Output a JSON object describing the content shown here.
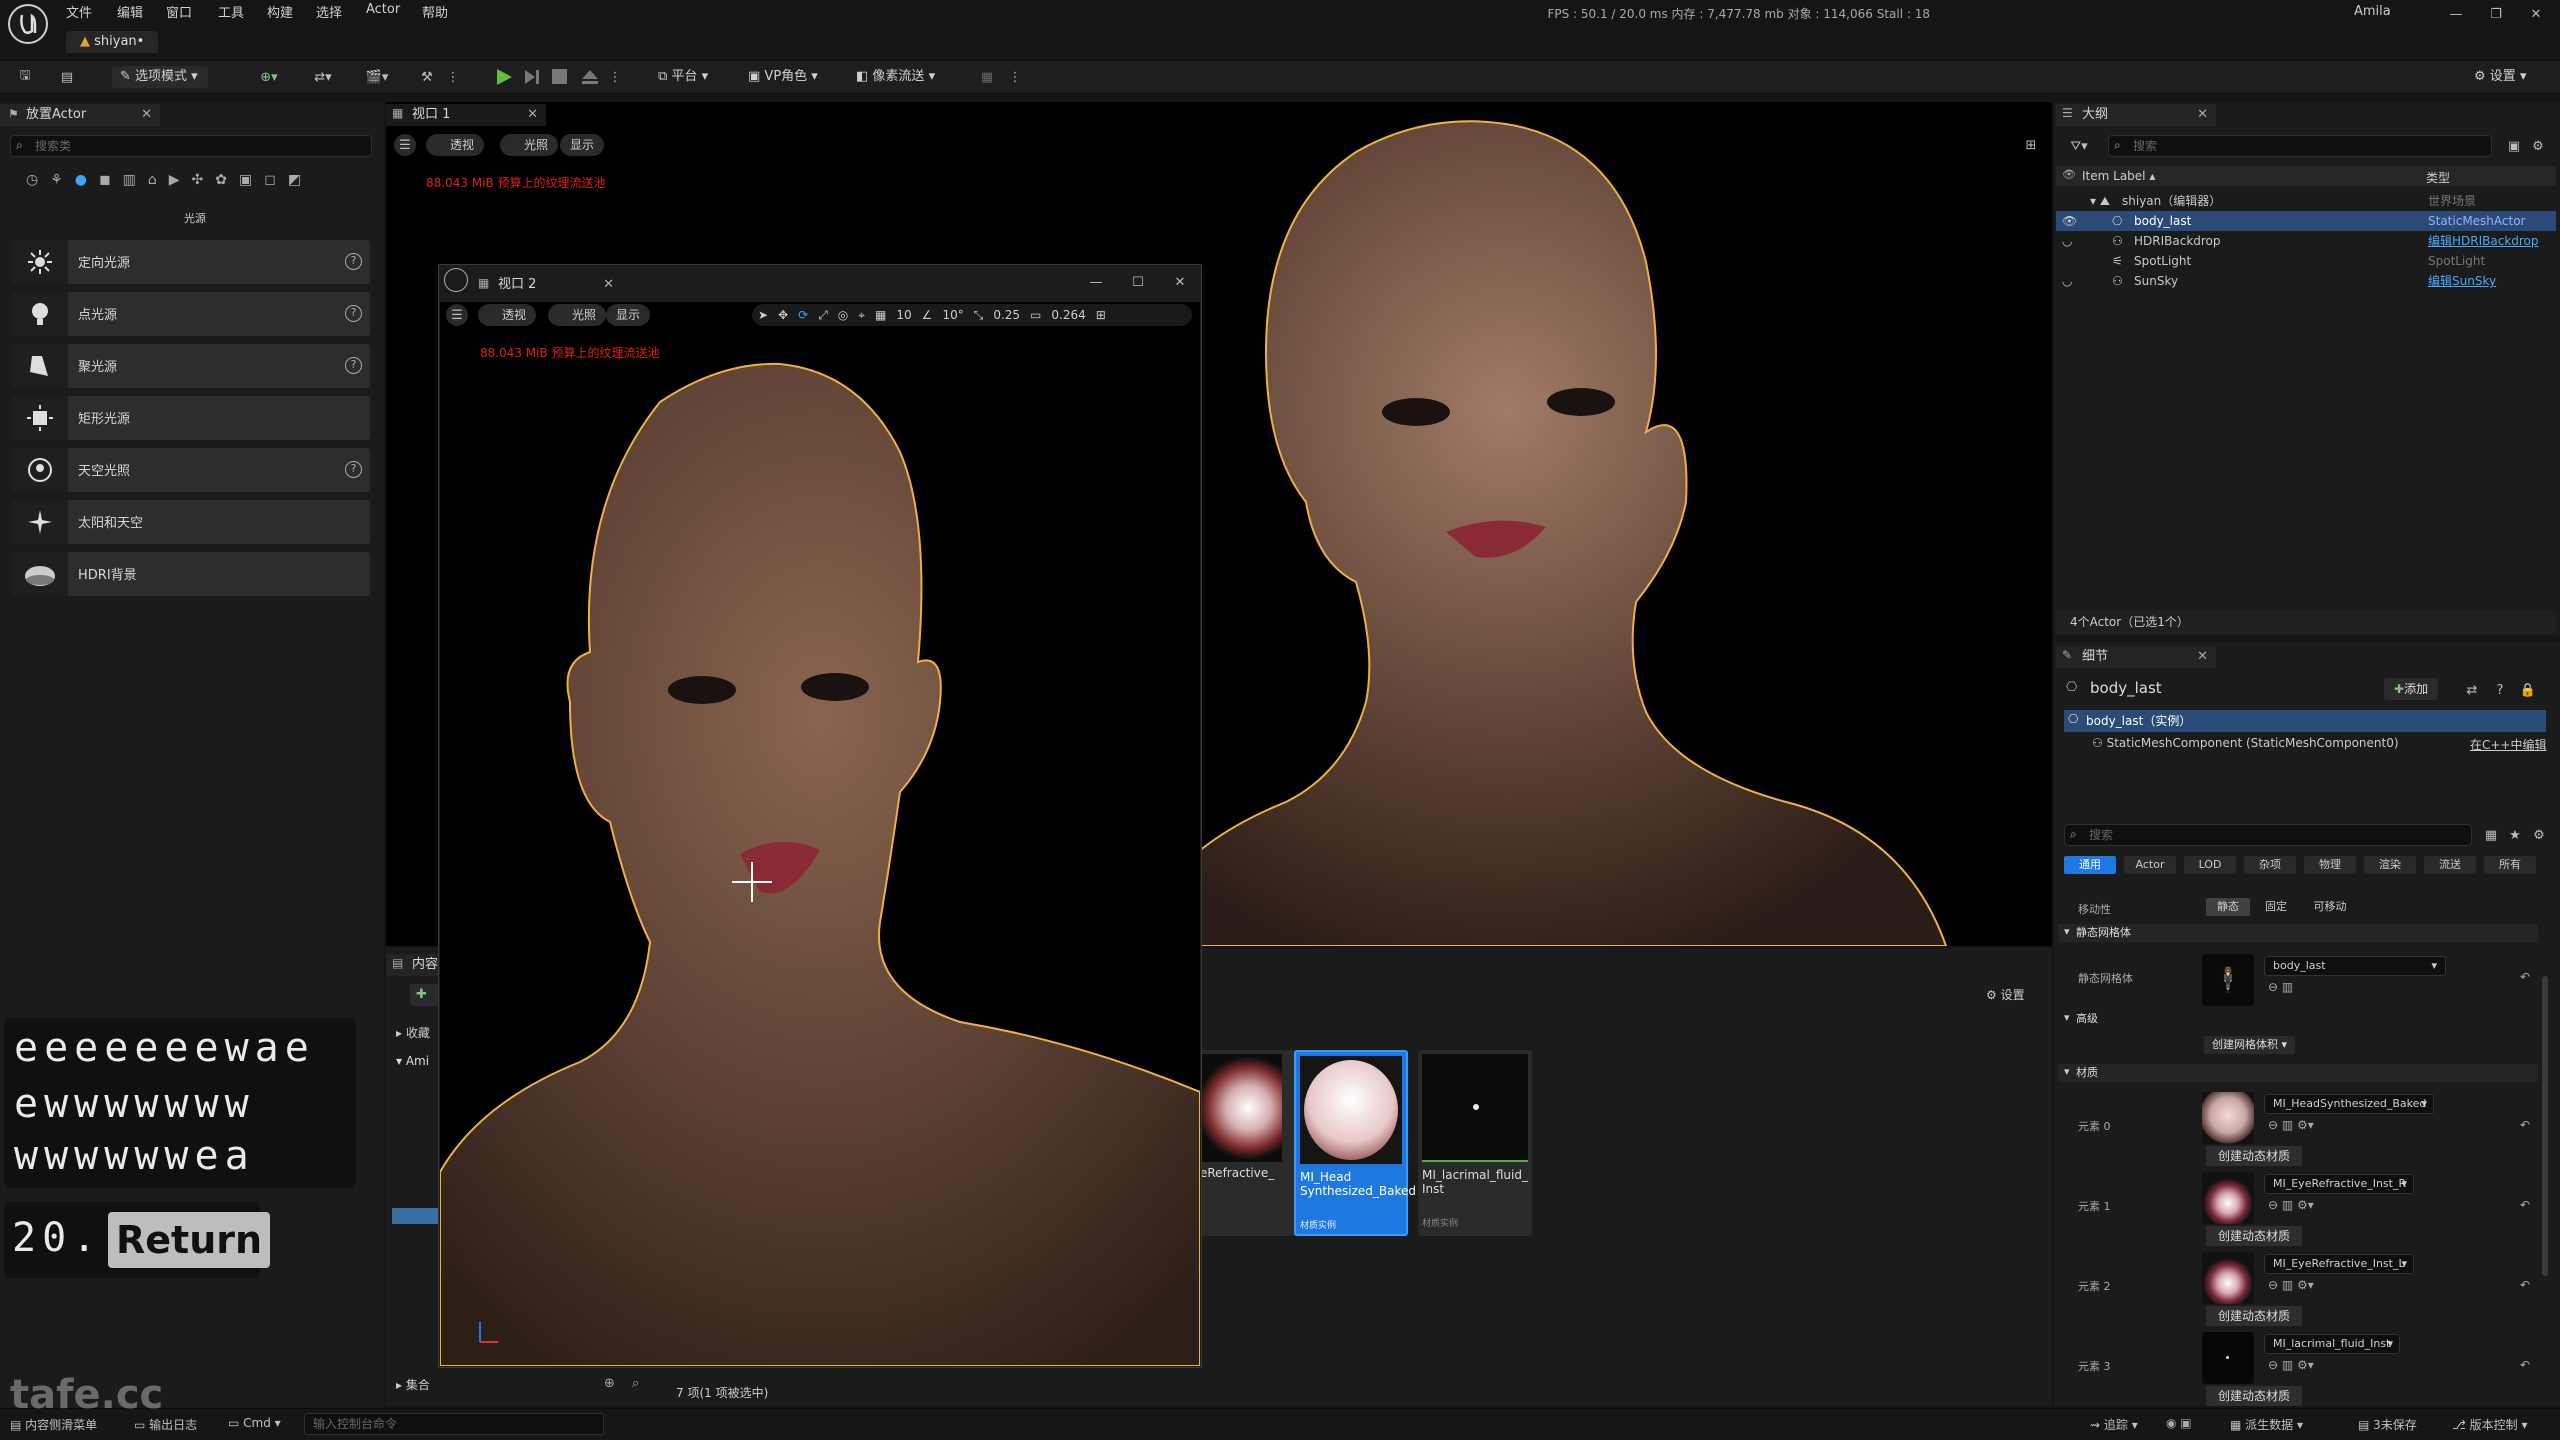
{
  "menubar": {
    "items": [
      "文件",
      "编辑",
      "窗口",
      "工具",
      "构建",
      "选择",
      "Actor",
      "帮助"
    ],
    "project_tab": "shiyan•",
    "stats": "FPS : 50.1  /  20.0 ms  内存 : 7,477.78 mb  对象 : 114,066  Stall : 18",
    "user": "Amila"
  },
  "toolbar": {
    "mode": "选项模式",
    "platform": "平台",
    "vp_role": "VP角色",
    "pixel_stream": "像素流送",
    "settings": "设置"
  },
  "place_actor": {
    "tab": "放置Actor",
    "search_placeholder": "搜索类",
    "category": "光源",
    "items": [
      {
        "label": "定向光源",
        "icon": "directional-light-icon",
        "help": true
      },
      {
        "label": "点光源",
        "icon": "point-light-icon",
        "help": true
      },
      {
        "label": "聚光源",
        "icon": "spot-light-icon",
        "help": true
      },
      {
        "label": "矩形光源",
        "icon": "rect-light-icon",
        "help": false
      },
      {
        "label": "天空光照",
        "icon": "sky-light-icon",
        "help": true
      },
      {
        "label": "太阳和天空",
        "icon": "sun-sky-icon",
        "help": false
      },
      {
        "label": "HDRI背景",
        "icon": "hdri-icon",
        "help": false
      }
    ]
  },
  "keystrokes": {
    "line1": "eeeeeeewae",
    "line2": "ewwwwwww",
    "line3": "wwwwwwea",
    "counter": "20.",
    "key": "Return"
  },
  "viewport1": {
    "tab": "视口 1",
    "perspective": "透视",
    "lit": "光照",
    "show": "显示",
    "warning": "88.043 MiB 预算上的纹理流送池"
  },
  "viewport2": {
    "tab": "视口 2",
    "perspective": "透视",
    "lit": "光照",
    "show": "显示",
    "warning": "88.043 MiB 预算上的纹理流送池",
    "grid": "10",
    "angle": "10°",
    "scale": "0.25",
    "camera": "0.264"
  },
  "content": {
    "tab": "内容",
    "collections": "收藏",
    "folder": "Ami",
    "settings": "设置",
    "sets": "集合",
    "status": "7 项(1 项被选中)",
    "assets": [
      {
        "name": "eRefractive_",
        "type": ""
      },
      {
        "name": "MI_Head Synthesized_Baked",
        "type": "材质实例"
      },
      {
        "name": "MI_lacrimal_fluid_ Inst",
        "type": "材质实例"
      }
    ]
  },
  "outliner": {
    "tab": "大纲",
    "search_placeholder": "搜索",
    "col_label": "Item Label ▴",
    "col_type": "类型",
    "rows": [
      {
        "label": "shiyan（编辑器）",
        "type": "世界场景",
        "link": false,
        "selected": false
      },
      {
        "label": "body_last",
        "type": "StaticMeshActor",
        "link": false,
        "selected": true
      },
      {
        "label": "HDRIBackdrop",
        "type": "编辑HDRIBackdrop",
        "link": true,
        "selected": false
      },
      {
        "label": "SpotLight",
        "type": "SpotLight",
        "link": false,
        "selected": false
      },
      {
        "label": "SunSky",
        "type": "编辑SunSky",
        "link": true,
        "selected": false
      }
    ],
    "count": "4个Actor（已选1个）"
  },
  "details": {
    "tab": "细节",
    "actor": "body_last",
    "add": "添加",
    "instance": "body_last（实例）",
    "component": "StaticMeshComponent (StaticMeshComponent0)",
    "edit_cpp": "在C++中编辑",
    "search_placeholder": "搜索",
    "tabs": [
      "通用",
      "Actor",
      "LOD",
      "杂项",
      "物理",
      "渲染",
      "流送",
      "所有"
    ],
    "mobility": "移动性",
    "mob_static": "静态",
    "mob_stationary": "固定",
    "mob_movable": "可移动",
    "sec_static_mesh": "静态网格体",
    "static_mesh_label": "静态网格体",
    "mesh_value": "body_last",
    "sec_advanced": "高级",
    "create_mesh": "创建网格体积",
    "sec_materials": "材质",
    "create_dynamic": "创建动态材质",
    "materials": [
      {
        "slot": "元素 0",
        "value": "MI_HeadSynthesized_Baked"
      },
      {
        "slot": "元素 1",
        "value": "MI_EyeRefractive_Inst_R"
      },
      {
        "slot": "元素 2",
        "value": "MI_EyeRefractive_Inst_L"
      },
      {
        "slot": "元素 3",
        "value": "MI_lacrimal_fluid_Inst"
      }
    ]
  },
  "statusbar": {
    "content_drawer": "内容侧滑菜单",
    "output_log": "输出日志",
    "cmd": "Cmd",
    "cmd_placeholder": "输入控制台命令",
    "trace": "追踪",
    "derived": "派生数据",
    "unsaved": "3未保存",
    "source_control": "版本控制",
    "watermark": "tafe.cc"
  }
}
